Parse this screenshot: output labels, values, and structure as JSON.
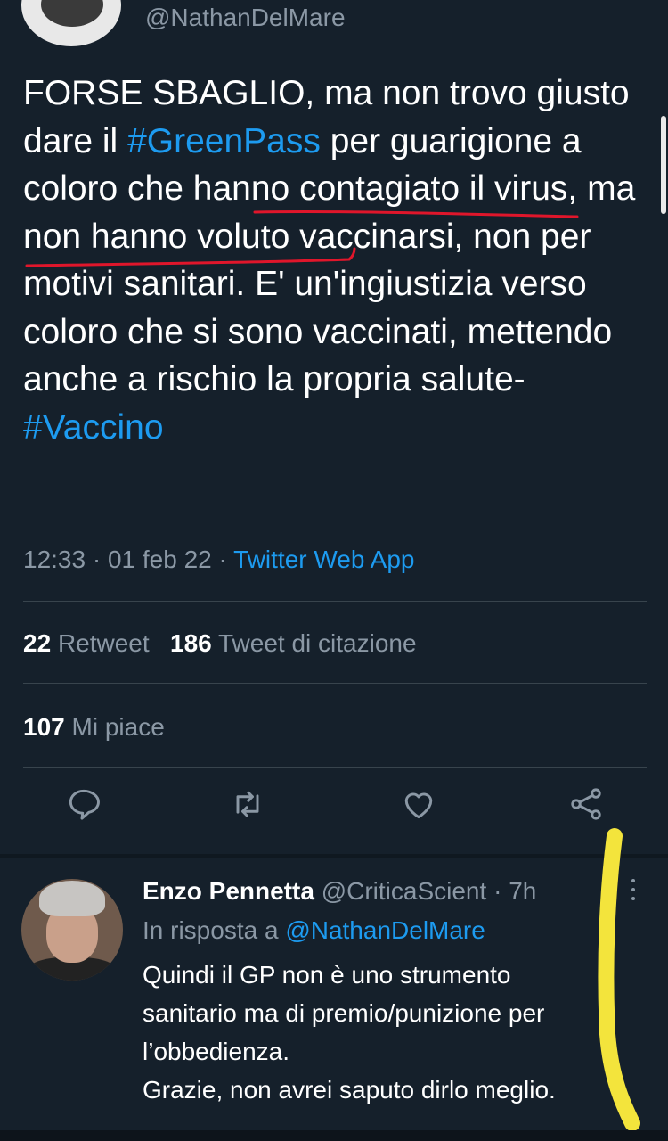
{
  "tweet": {
    "handle": "@NathanDelMare",
    "text_part1": "FORSE SBAGLIO, ma non trovo giusto dare il ",
    "hashtag1": "#GreenPass",
    "text_part2": " per guarigione a ",
    "underlined_1": "coloro che hanno",
    "underlined_2": "contagiato il virus",
    "text_part3": ", ma non hanno voluto vaccinarsi, non per motivi sanitari. E' un'ingiustizia verso coloro che si sono vaccinati, mettendo anche a rischio la propria salute- ",
    "hashtag2": "#Vaccino",
    "time": "12:33",
    "date": "01 feb 22",
    "separator": " · ",
    "app": "Twitter Web App",
    "retweets_count": "22",
    "retweets_label": "Retweet",
    "quotes_count": "186",
    "quotes_label": "Tweet di citazione",
    "likes_count": "107",
    "likes_label": "Mi piace"
  },
  "actions": [
    {
      "icon": "reply-icon"
    },
    {
      "icon": "retweet-icon"
    },
    {
      "icon": "like-icon"
    },
    {
      "icon": "share-icon"
    }
  ],
  "reply": {
    "name": "Enzo Pennetta",
    "handle": "@CriticaScient",
    "time": "7h",
    "in_reply_prefix": "In risposta a ",
    "in_reply_mention": "@NathanDelMare",
    "line1": "Quindi il GP non è uno strumento",
    "line2": "sanitario ma di premio/punizione per",
    "line3": "l’obbedienza.",
    "line4": "Grazie, non avrei saputo dirlo meglio."
  },
  "colors": {
    "background": "#15202b",
    "text": "#ffffff",
    "secondary": "#8b98a5",
    "accent": "#1d9bf0",
    "red_underline": "#e0162b",
    "yellow_mark": "#f3e43c"
  }
}
